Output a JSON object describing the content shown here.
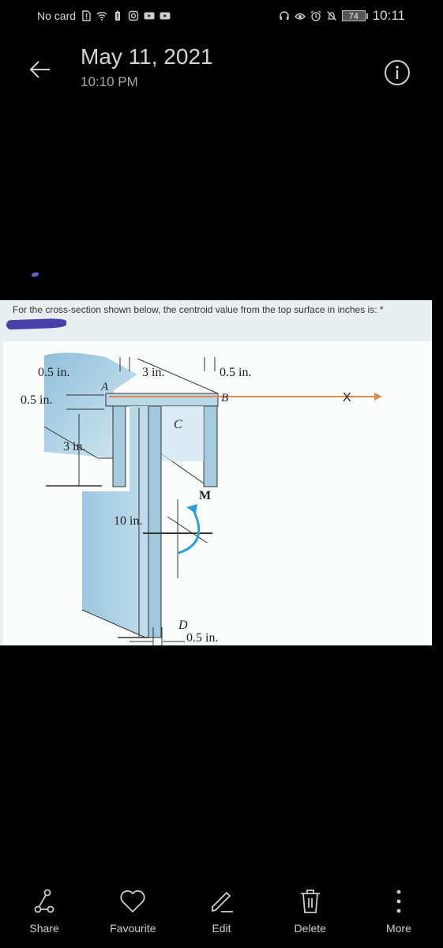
{
  "status_bar": {
    "carrier": "No card",
    "left_icons": [
      "sim-alert-icon",
      "wifi-icon",
      "battery-alert-icon",
      "instagram-icon",
      "youtube-icon",
      "youtube-icon"
    ],
    "right_icons": [
      "headset-icon",
      "eye-icon",
      "alarm-icon",
      "bell-off-icon"
    ],
    "battery_level": "74",
    "time": "10:11"
  },
  "header": {
    "title": "May 11, 2021",
    "subtitle": "10:10 PM",
    "back_icon": "back-arrow-icon",
    "info_icon": "info-icon"
  },
  "photo": {
    "question": "For the cross-section shown below, the centroid value from the top surface in inches is: *",
    "diagram_labels": {
      "flange_left_width": "0.5 in.",
      "web_spacing": "3 in.",
      "flange_right_width": "0.5 in.",
      "flange_thickness": "0.5 in.",
      "side_depth": "3 in.",
      "web_depth": "10 in.",
      "web_thickness": "0.5 in.",
      "point_a": "A",
      "point_b": "B",
      "point_c": "C",
      "point_d": "D",
      "moment": "M",
      "axis": "X"
    },
    "colors": {
      "axis_line": "#e0894f",
      "moment_arrow": "#2a9fd6",
      "section_fill": "#a9cfe2"
    }
  },
  "toolbar": {
    "items": [
      {
        "label": "Share",
        "icon": "share-icon"
      },
      {
        "label": "Favourite",
        "icon": "heart-icon"
      },
      {
        "label": "Edit",
        "icon": "pencil-icon"
      },
      {
        "label": "Delete",
        "icon": "trash-icon"
      },
      {
        "label": "More",
        "icon": "more-vertical-icon"
      }
    ]
  }
}
